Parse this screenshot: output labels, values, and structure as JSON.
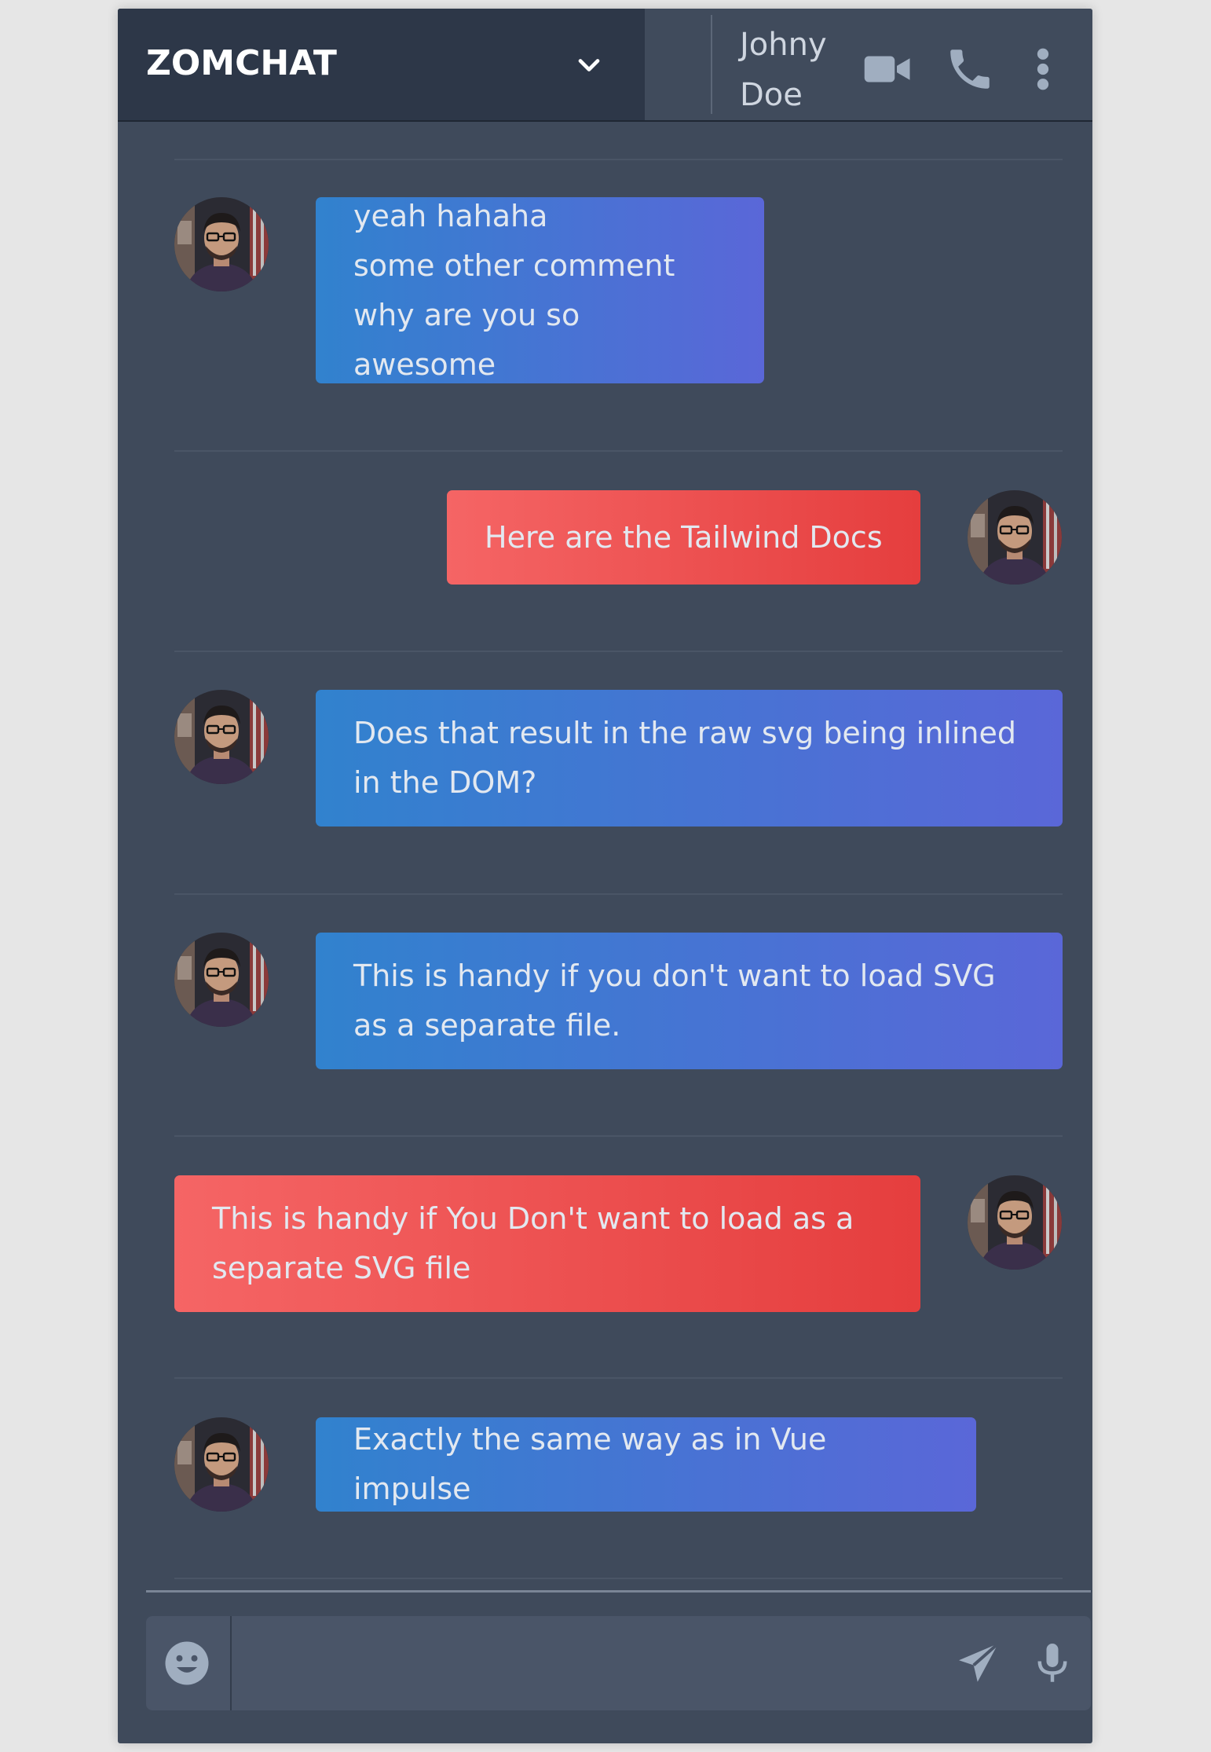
{
  "header": {
    "brand": "ZOMCHAT",
    "contact_name": "Johny Doe",
    "icons": [
      "chevron-down-icon",
      "video-camera-icon",
      "phone-icon",
      "more-vertical-icon"
    ]
  },
  "colors": {
    "header_dark": "#2d3748",
    "panel": "#3f4a5b",
    "received_gradient": [
      "#3182ce",
      "#5a67d8"
    ],
    "sent_gradient": [
      "#f56565",
      "#e53e3e"
    ],
    "composer": "#4a5568",
    "icon": "#a0aec0"
  },
  "messages": [
    {
      "direction": "received",
      "text": "yeah hahaha\nsome other comment\nwhy are you so awesome"
    },
    {
      "direction": "sent",
      "text": "Here are the Tailwind Docs"
    },
    {
      "direction": "received",
      "text": "Does that result in the raw svg being inlined in the DOM?"
    },
    {
      "direction": "received",
      "text": "This is handy if you don't want to load SVG as a separate file."
    },
    {
      "direction": "sent",
      "text": "This is handy if You Don't want to load as a separate SVG file"
    },
    {
      "direction": "received",
      "text": "Exactly the same way as in Vue impulse"
    }
  ],
  "composer": {
    "value": "",
    "placeholder": "",
    "icons": [
      "emoji-icon",
      "send-icon",
      "microphone-icon"
    ]
  }
}
